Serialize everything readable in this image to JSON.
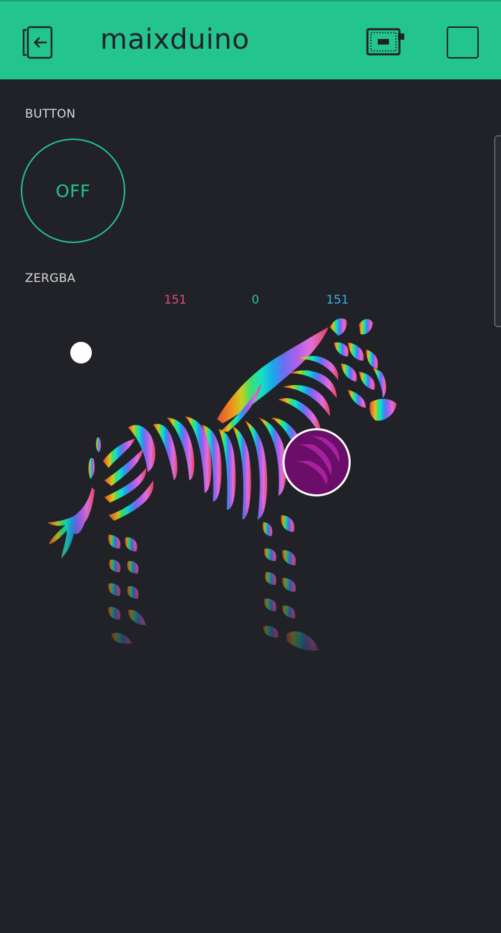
{
  "header": {
    "title": "maixduino",
    "back_icon": "exit-icon",
    "device_icon": "board-icon",
    "stop_icon": "stop-icon",
    "accent": "#23c48e"
  },
  "widgets": {
    "button": {
      "label": "BUTTON",
      "state": "OFF",
      "color": "#23c48e"
    },
    "zergba": {
      "label": "ZERGBA",
      "r": "151",
      "g": "0",
      "b": "151",
      "r_color": "#e24d6e",
      "g_color": "#23c48e",
      "b_color": "#2fb6e8",
      "selected_color": "#970097"
    }
  }
}
